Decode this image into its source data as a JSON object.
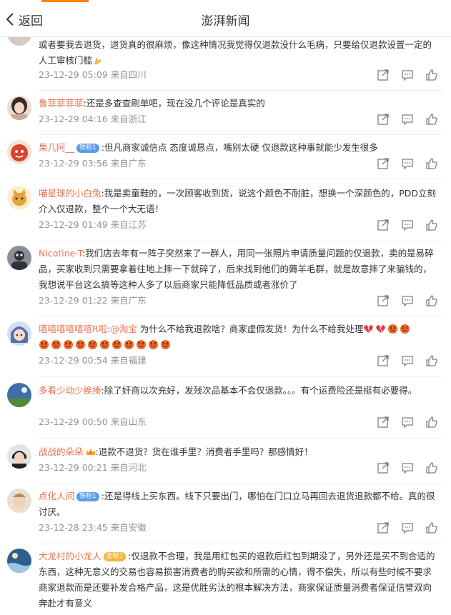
{
  "header": {
    "back_label": "返回",
    "title": "澎湃新闻",
    "accent_color": "#ff8200"
  },
  "colors": {
    "username": "#eb7350",
    "meta": "#939393",
    "text": "#333333"
  },
  "comments": [
    {
      "text": "或者要我去退货，退货真的很麻烦，像这种情况我觉得仅退款没什么毛病，只要给仅退款设置一定的人工审核门槛",
      "time": "23-12-29 05:09",
      "location": "来自四川",
      "avatar_icon": "partial-avatar-icon"
    },
    {
      "username": "鲁菲菲菲菲",
      "text": ":还是多查查刷单吧，现在没几个评论是真实的",
      "time": "23-12-29 04:16",
      "location": "来自浙江",
      "avatar_icon": "girl-photo-avatar-icon"
    },
    {
      "username": "果几阿__",
      "badge": "铁粉1",
      "text": ":但凡商家诚信点 态度诚恳点，嘴别太硬 仅退款这种事就能少发生很多",
      "time": "23-12-29 03:56",
      "location": "来自广东",
      "avatar_icon": "red-cartoon-avatar-icon"
    },
    {
      "username": "喵星球的小白兔",
      "text": ":我是卖童鞋的，一次顾客收到货，说这个颜色不耐脏，想换一个深颜色的，PDD立刻介入仅退款，整个一个大无语！",
      "time": "23-12-29 01:49",
      "location": "来自江苏",
      "avatar_icon": "cat-avatar-icon"
    },
    {
      "username": "Nicotine-T",
      "text": ":我们店去年有一阵子突然来了一群人，用同一张照片申请质量问题的仅退款，卖的是易碎品，买家收到只需要拿着往地上摔一下就碎了，后来找到他们的薅羊毛群，就是故意摔了来骗钱的，我想说平台这么搞等这种人多了以后商家只能降低品质或者涨价了",
      "time": "23-12-29 01:22",
      "location": "来自广东",
      "avatar_icon": "dark-photo-avatar-icon"
    },
    {
      "username": "嘻嘻嘻嘻嘻嘻R啦",
      "mention": "@淘宝",
      "text": " 为什么不给我退款啥？商家虚假发货！为什么不给我处理",
      "emojis_line1": [
        "broken-heart-emoji",
        "broken-heart-emoji",
        "angry-face-emoji",
        "angry-face-emoji"
      ],
      "emojis_line2": [
        "angry-face-emoji",
        "angry-face-emoji",
        "angry-face-emoji",
        "angry-face-emoji",
        "angry-face-emoji",
        "angry-face-emoji",
        "angry-face-emoji",
        "angry-face-emoji",
        "angry-face-emoji",
        "angry-face-emoji",
        "angry-face-emoji"
      ],
      "time": "23-12-29 00:54",
      "location": "来自福建",
      "avatar_icon": "anime-avatar-icon"
    },
    {
      "username": "多看少动少挨揍",
      "text": ":除了奸商以次充好，发残次品基本不会仅退款。。。有个运费险还是挺有必要得。",
      "time": "23-12-29 00:50",
      "location": "来自山东",
      "avatar_icon": "sky-avatar-icon"
    },
    {
      "username": "战战的朵朵",
      "text": ":退款不退货？货在谁手里？消费者手里吗？那感情好！",
      "time": "23-12-29 00:21",
      "location": "来自河北",
      "avatar_icon": "portrait-avatar-icon"
    },
    {
      "username": "点化人间",
      "badge": "铁粉1",
      "text": ":还是得线上买东西。线下只要出门，哪怕在门口立马再回去退货退款都不给。真的很讨厌。",
      "time": "23-12-28 23:45",
      "location": "来自安徽",
      "avatar_icon": "face-avatar-icon"
    },
    {
      "username": "大龙村的小龙人",
      "badge": "金粉1",
      "text": ":仅退款不合理，我是用红包买的退款后红包到期没了，另外还是买不到合适的东西，这种无意义的交易也容易损害消费者的购买欲和所需的心情，得不偿失，所以有些时候不要求商家退款而是还要补发合格产品，这是优胜劣汰的根本解决方法，商家保证质量消费者保证信誉双向奔赴才有意义",
      "avatar_icon": "ocean-avatar-icon"
    }
  ],
  "action_icons": [
    "share-icon",
    "comment-icon",
    "like-icon"
  ]
}
